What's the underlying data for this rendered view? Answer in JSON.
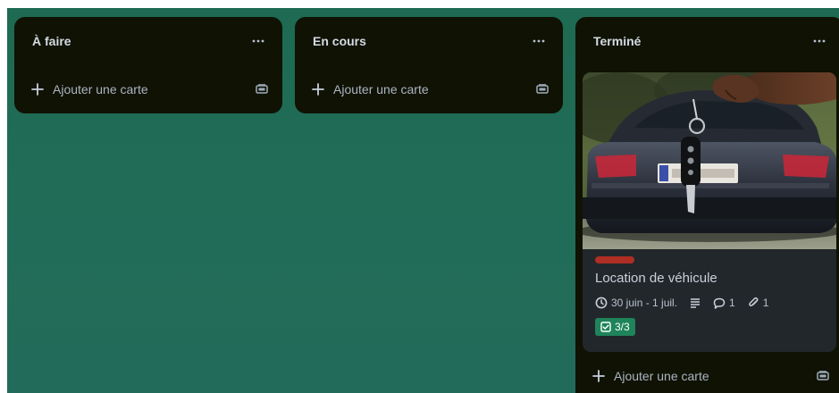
{
  "lists": [
    {
      "title": "À faire",
      "add_card_label": "Ajouter une carte"
    },
    {
      "title": "En cours",
      "add_card_label": "Ajouter une carte"
    },
    {
      "title": "Terminé",
      "add_card_label": "Ajouter une carte",
      "cards": [
        {
          "title": "Location de véhicule",
          "label_color": "#ae2e24",
          "dates": "30 juin - 1 juil.",
          "comments": "1",
          "attachments": "1",
          "checklist": "3/3",
          "cover_icon": "car-key-photo"
        }
      ]
    }
  ],
  "colors": {
    "board_background": "#216c57",
    "list_background": "#101204",
    "card_background": "#22272b",
    "checklist_complete": "#1f845a"
  },
  "icons": {
    "list_menu": "ellipsis-icon",
    "add": "plus-icon",
    "template": "card-template-icon",
    "dates": "clock-icon",
    "description": "description-icon",
    "comments": "comment-icon",
    "attachments": "paperclip-icon",
    "checklist": "checklist-icon"
  }
}
